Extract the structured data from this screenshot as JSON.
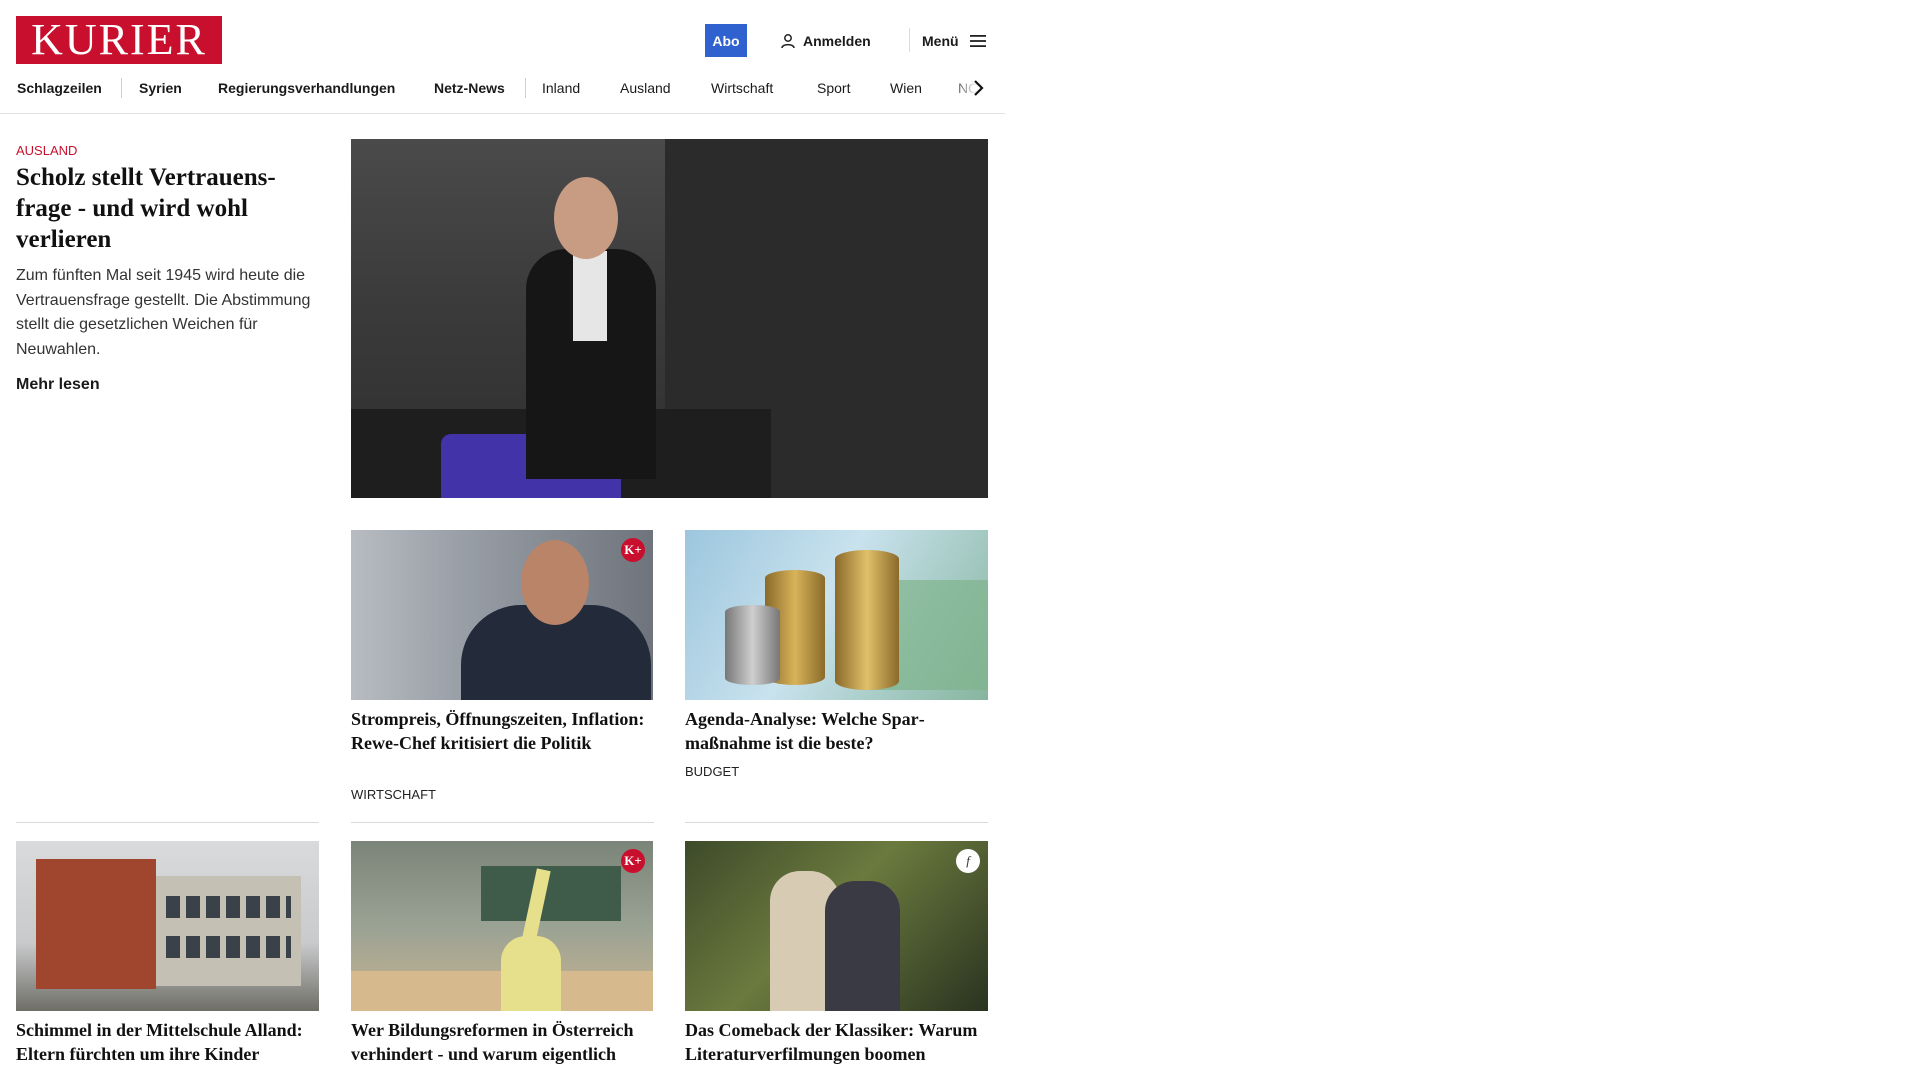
{
  "header": {
    "logo_text": "KURIER",
    "abo_label": "Abo",
    "login_label": "Anmelden",
    "menu_label": "Menü",
    "brand_color": "#c8102e",
    "abo_color": "#2f62cf"
  },
  "nav": {
    "items": [
      {
        "label": "Schlagzeilen"
      },
      {
        "label": "Syrien"
      },
      {
        "label": "Regierungsverhandlungen"
      },
      {
        "label": "Netz-News"
      },
      {
        "label": "Inland"
      },
      {
        "label": "Ausland"
      },
      {
        "label": "Wirtschaft"
      },
      {
        "label": "Sport"
      },
      {
        "label": "Wien"
      },
      {
        "label": "NÖ"
      }
    ],
    "scroll_icon": "chevron-right-icon"
  },
  "lead": {
    "category": "AUSLAND",
    "title": "Scholz stellt Vertrauens­frage - und wird wohl verlieren",
    "teaser": "Zum fünften Mal seit 1945 wird heute die Vertrauensfrage gestellt. Die Abstimmung stellt die gesetzlichen Weichen für Neuwahlen.",
    "more_label": "Mehr lesen"
  },
  "cards": [
    {
      "title": "Strompreis, Öffnungszeiten, Infla­tion: Rewe-Chef kritisiert die Politik",
      "category": "WIRTSCHAFT",
      "badge": "K+"
    },
    {
      "title": "Agenda-Analyse: Welche Spar­maßnahme ist die beste?",
      "category": "BUDGET",
      "badge": ""
    },
    {
      "title": "Schimmel in der Mittelschule Al­land: Eltern fürchten um ihre Kinder",
      "category": "",
      "badge": ""
    },
    {
      "title": "Wer Bildungsreformen in Öster­reich verhindert - und warum eigentlich",
      "category": "",
      "badge": "K+"
    },
    {
      "title": "Das Comeback der Klassiker: Warum Literaturverfilmungen boomen",
      "category": "",
      "badge": "f"
    }
  ]
}
